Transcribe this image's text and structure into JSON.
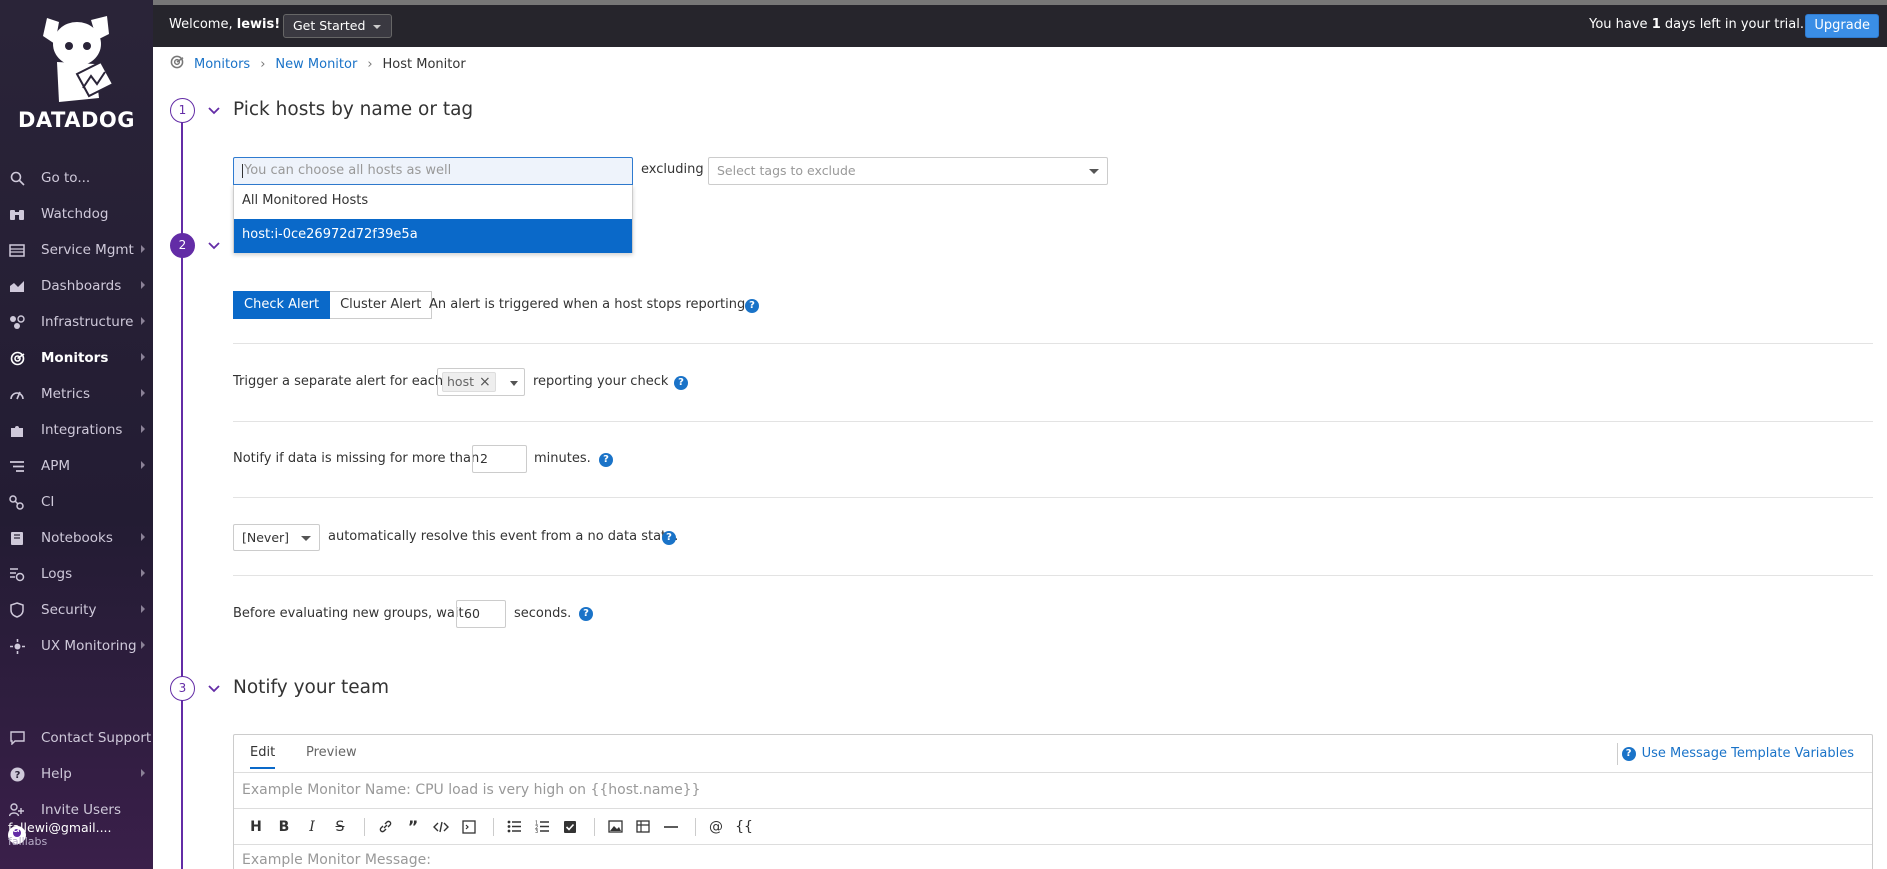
{
  "sidebar": {
    "brand": "DATADOG",
    "items": [
      {
        "label": "Go to...",
        "icon": "search-icon",
        "arrow": false,
        "active": false
      },
      {
        "label": "Watchdog",
        "icon": "binoculars-icon",
        "arrow": false,
        "active": false
      },
      {
        "label": "Service Mgmt",
        "icon": "service-icon",
        "arrow": true,
        "active": false
      },
      {
        "label": "Dashboards",
        "icon": "chart-icon",
        "arrow": true,
        "active": false
      },
      {
        "label": "Infrastructure",
        "icon": "infrastructure-icon",
        "arrow": true,
        "active": false
      },
      {
        "label": "Monitors",
        "icon": "monitor-icon",
        "arrow": true,
        "active": true
      },
      {
        "label": "Metrics",
        "icon": "metrics-icon",
        "arrow": true,
        "active": false
      },
      {
        "label": "Integrations",
        "icon": "puzzle-icon",
        "arrow": true,
        "active": false
      },
      {
        "label": "APM",
        "icon": "apm-icon",
        "arrow": true,
        "active": false
      },
      {
        "label": "CI",
        "icon": "ci-icon",
        "arrow": false,
        "active": false
      },
      {
        "label": "Notebooks",
        "icon": "notebook-icon",
        "arrow": true,
        "active": false
      },
      {
        "label": "Logs",
        "icon": "logs-icon",
        "arrow": true,
        "active": false
      },
      {
        "label": "Security",
        "icon": "shield-icon",
        "arrow": true,
        "active": false
      },
      {
        "label": "UX Monitoring",
        "icon": "ux-icon",
        "arrow": true,
        "active": false
      }
    ],
    "bottom_items": [
      {
        "label": "Contact Support",
        "icon": "chat-icon",
        "arrow": false
      },
      {
        "label": "Help",
        "icon": "help-icon",
        "arrow": true
      },
      {
        "label": "Invite Users",
        "icon": "users-icon",
        "arrow": false
      }
    ],
    "user": {
      "email": "fallewi@gmail....",
      "org": "falllabs"
    }
  },
  "topbar": {
    "welcome_prefix": "Welcome,",
    "username": "lewis!",
    "get_started": "Get Started",
    "trial_prefix": "You have",
    "trial_days": "1",
    "trial_suffix": "days left in your trial.",
    "upgrade": "Upgrade"
  },
  "breadcrumb": {
    "monitors": "Monitors",
    "new_monitor": "New Monitor",
    "current": "Host Monitor"
  },
  "steps": {
    "step1": {
      "number": "1",
      "title": "Pick hosts by name or tag"
    },
    "step2": {
      "number": "2"
    },
    "step3": {
      "number": "3",
      "title": "Notify your team"
    }
  },
  "host_picker": {
    "placeholder": "You can choose all hosts as well",
    "options": [
      "All Monitored Hosts",
      "host:i-0ce26972d72f39e5a"
    ],
    "excluding_label": "excluding",
    "exclude_placeholder": "Select tags to exclude"
  },
  "alert_conditions": {
    "check_alert": "Check Alert",
    "cluster_alert": "Cluster Alert",
    "alert_desc": "An alert is triggered when a host stops reporting.",
    "trigger_prefix": "Trigger a separate alert for each",
    "trigger_tag": "host",
    "trigger_suffix": "reporting your check",
    "notify_prefix": "Notify if data is missing for more than",
    "notify_value": "2",
    "notify_suffix": "minutes.",
    "resolve_value": "[Never]",
    "resolve_suffix": "automatically resolve this event from a no data state.",
    "wait_prefix": "Before evaluating new groups, wait",
    "wait_value": "60",
    "wait_suffix": "seconds."
  },
  "editor": {
    "tab_edit": "Edit",
    "tab_preview": "Preview",
    "template_link": "Use Message Template Variables",
    "name_placeholder": "Example Monitor Name: CPU load is very high on {{host.name}}",
    "message_placeholder": "Example Monitor Message:",
    "toolbar": [
      "H",
      "B",
      "I",
      "S",
      "link",
      "quote",
      "code",
      "code-block",
      "bullet-list",
      "numbered-list",
      "checklist",
      "image",
      "table",
      "hr",
      "@",
      "{{"
    ]
  },
  "colors": {
    "brand_purple": "#632ca6",
    "accent_blue": "#0a69c9",
    "topbar": "#26252c"
  }
}
